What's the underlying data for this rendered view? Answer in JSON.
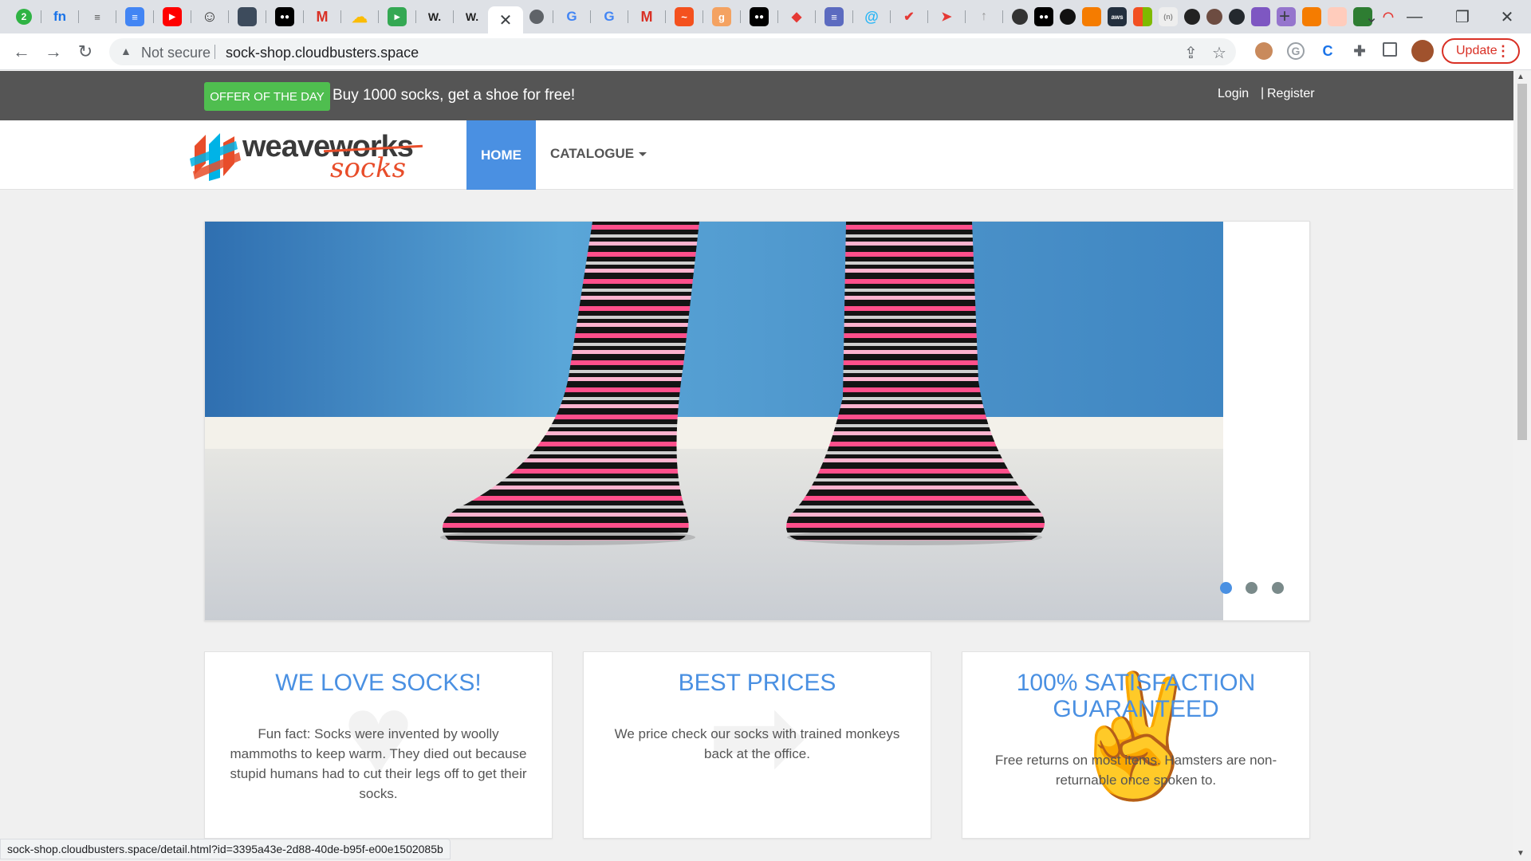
{
  "browser": {
    "active_tab_close": "✕",
    "new_tab": "+",
    "address": {
      "security_label": "Not secure",
      "url": "sock-shop.cloudbusters.space"
    },
    "update_label": "Update",
    "status_url": "sock-shop.cloudbusters.space/detail.html?id=3395a43e-2d88-40de-b95f-e00e1502085b"
  },
  "offer": {
    "badge": "OFFER OF THE DAY",
    "text": "Buy 1000 socks, get a shoe for free!"
  },
  "account": {
    "login": "Login",
    "separator": "|",
    "register": "Register"
  },
  "logo": {
    "word1": "weaveworks",
    "word2": "socks"
  },
  "nav": {
    "home": "HOME",
    "catalogue": "CATALOGUE"
  },
  "carousel": {
    "slides": 3,
    "active_slide": 1
  },
  "features": [
    {
      "title": "WE LOVE SOCKS!",
      "body": "Fun fact: Socks were invented by woolly mammoths to keep warm. They died out because stupid humans had to cut their legs off to get their socks."
    },
    {
      "title": "BEST PRICES",
      "body": "We price check our socks with trained monkeys back at the office."
    },
    {
      "title": "100% SATISFACTION GUARANTEED",
      "body": "Free returns on most items. Hamsters are non-returnable once spoken to."
    }
  ],
  "colors": {
    "accent": "#4a90e2",
    "offer_badge": "#4fbe4f",
    "offer_bar": "#555555",
    "logo_orange": "#e84d2a"
  }
}
